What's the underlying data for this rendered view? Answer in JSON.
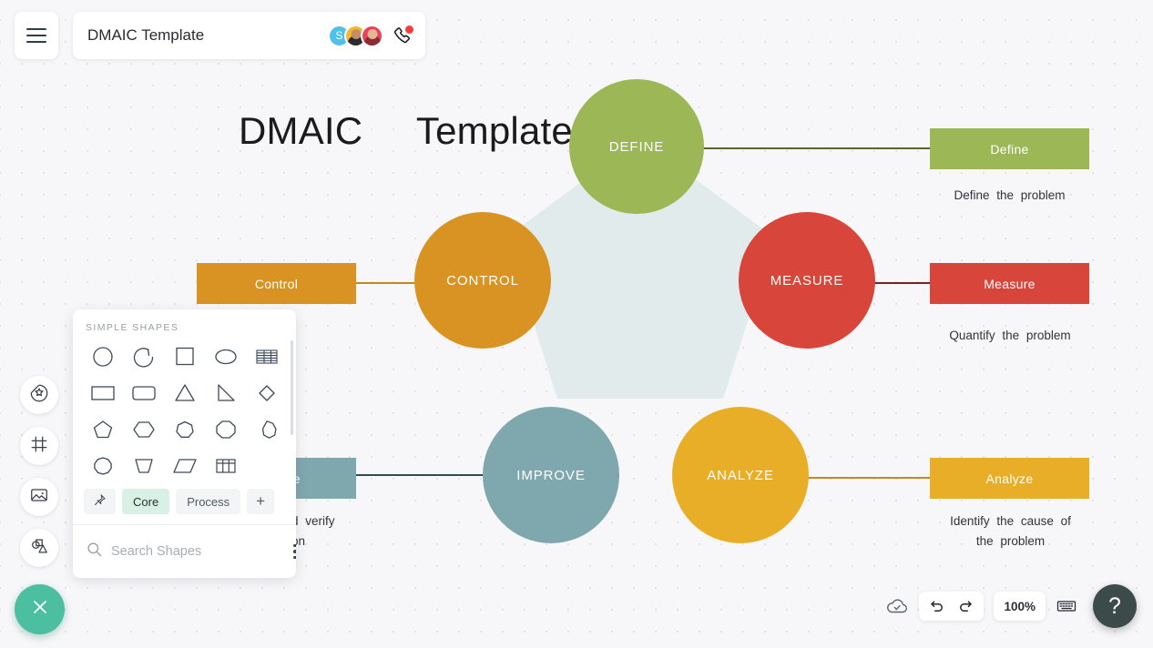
{
  "topbar": {
    "menu_icon": "hamburger-menu-icon",
    "document_title": "DMAIC Template",
    "avatars": [
      {
        "name": "avatar-s",
        "initial": "S",
        "color": "#4FC0E8"
      },
      {
        "name": "avatar-user-2",
        "initial": "",
        "color": "#F2B733"
      },
      {
        "name": "avatar-user-3",
        "initial": "",
        "color": "#E8435A"
      }
    ],
    "call_icon": "phone-call-icon",
    "call_badge": true
  },
  "rail": {
    "items": [
      {
        "name": "sticker-shapes-icon"
      },
      {
        "name": "frame-icon"
      },
      {
        "name": "image-icon"
      },
      {
        "name": "shapes-library-icon"
      }
    ],
    "close_icon": "close-icon"
  },
  "canvas": {
    "title": "DMAIC     Template",
    "pentagon_color": "#e2ebec",
    "nodes": [
      {
        "label": "DEFINE",
        "color": "#9cb755"
      },
      {
        "label": "MEASURE",
        "color": "#d8453a"
      },
      {
        "label": "ANALYZE",
        "color": "#e9ae28"
      },
      {
        "label": "IMPROVE",
        "color": "#7fa8ae"
      },
      {
        "label": "CONTROL",
        "color": "#d89323"
      }
    ],
    "cards": [
      {
        "label": "Define",
        "color": "#9cb755",
        "description": "Define   the  problem"
      },
      {
        "label": "Measure",
        "color": "#d8453a",
        "description": "Quantify   the  problem"
      },
      {
        "label": "Analyze",
        "color": "#e9ae28",
        "description": "Identify    the  cause  of\nthe  problem"
      },
      {
        "label": "Improve",
        "color": "#7fa8ae",
        "description": "d  verify"
      },
      {
        "label": "Control",
        "color": "#d89323",
        "description": "solution"
      }
    ]
  },
  "shapes_panel": {
    "heading": "SIMPLE SHAPES",
    "shapes": [
      {
        "name": "circle-shape"
      },
      {
        "name": "arc-shape"
      },
      {
        "name": "square-shape"
      },
      {
        "name": "ellipse-shape"
      },
      {
        "name": "striped-table-shape"
      },
      {
        "name": "rectangle-shape"
      },
      {
        "name": "rounded-rectangle-shape"
      },
      {
        "name": "triangle-shape"
      },
      {
        "name": "right-triangle-shape"
      },
      {
        "name": "diamond-shape"
      },
      {
        "name": "pentagon-shape"
      },
      {
        "name": "hexagon-shape"
      },
      {
        "name": "heptagon-shape"
      },
      {
        "name": "octagon-shape"
      },
      {
        "name": "nonagon-shape"
      },
      {
        "name": "decagon-shape"
      },
      {
        "name": "trapezoid-shape"
      },
      {
        "name": "parallelogram-shape"
      },
      {
        "name": "table-shape"
      }
    ],
    "tabs": [
      {
        "name": "pin-tab",
        "label": "",
        "icon": "pin-icon",
        "active": false
      },
      {
        "name": "core-tab",
        "label": "Core",
        "active": true
      },
      {
        "name": "process-tab",
        "label": "Process",
        "active": false
      },
      {
        "name": "add-tab",
        "label": "+",
        "active": false
      }
    ],
    "search_placeholder": "Search Shapes",
    "search_value": "",
    "more_icon": "kebab-menu-icon"
  },
  "bottombar": {
    "save_status_icon": "cloud-check-icon",
    "undo_icon": "undo-icon",
    "redo_icon": "redo-icon",
    "zoom_level": "100%",
    "keyboard_icon": "keyboard-icon",
    "help_label": "?"
  }
}
